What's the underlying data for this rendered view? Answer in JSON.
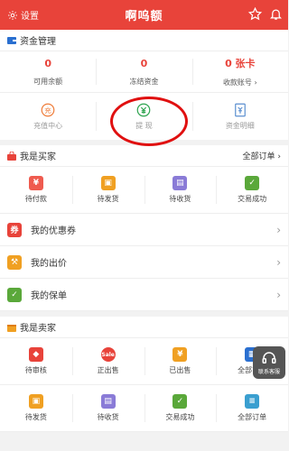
{
  "header": {
    "settings_label": "设置",
    "title": "啊呜额"
  },
  "funds": {
    "section_title": "资金管理",
    "stats": [
      {
        "value": "0",
        "label": "可用余额"
      },
      {
        "value": "0",
        "label": "冻结资金"
      },
      {
        "value": "0 张卡",
        "label": "收款账号 ›"
      }
    ],
    "tools": [
      {
        "label": "充值中心",
        "icon": "recharge-icon"
      },
      {
        "label": "提  现",
        "icon": "withdraw-icon"
      },
      {
        "label": "资金明细",
        "icon": "details-icon"
      }
    ]
  },
  "buyer": {
    "section_title": "我是买家",
    "more": "全部订单 ›",
    "grid": [
      {
        "label": "待付款",
        "icon": "wallet-icon",
        "color": "#ef5b4f"
      },
      {
        "label": "待发货",
        "icon": "box-cart-icon",
        "color": "#f0a022"
      },
      {
        "label": "待收货",
        "icon": "package-icon",
        "color": "#8a7bd7"
      },
      {
        "label": "交易成功",
        "icon": "clipboard-check-icon",
        "color": "#5aa83a"
      }
    ],
    "rows": [
      {
        "label": "我的优惠券",
        "icon": "coupon-icon",
        "color": "#e8433a"
      },
      {
        "label": "我的出价",
        "icon": "auction-hammer-icon",
        "color": "#f0a022"
      },
      {
        "label": "我的保单",
        "icon": "policy-icon",
        "color": "#5aa83a"
      }
    ]
  },
  "seller": {
    "section_title": "我是卖家",
    "grid_top": [
      {
        "label": "待审核",
        "icon": "shield-icon",
        "color": "#e8433a"
      },
      {
        "label": "正出售",
        "icon": "sale-tag-icon",
        "color": "#e8433a"
      },
      {
        "label": "已出售",
        "icon": "yen-bag-icon",
        "color": "#f0a022"
      },
      {
        "label": "全部商品",
        "icon": "goods-icon",
        "color": "#2a6fd0"
      }
    ],
    "grid_bottom": [
      {
        "label": "待发货",
        "icon": "box-cart-icon",
        "color": "#f0a022"
      },
      {
        "label": "待收货",
        "icon": "package-icon",
        "color": "#8a7bd7"
      },
      {
        "label": "交易成功",
        "icon": "clipboard-check-icon",
        "color": "#5aa83a"
      },
      {
        "label": "全部订单",
        "icon": "document-icon",
        "color": "#3a9fd0"
      }
    ]
  },
  "floating": {
    "customer_service_label": "联系客服"
  }
}
